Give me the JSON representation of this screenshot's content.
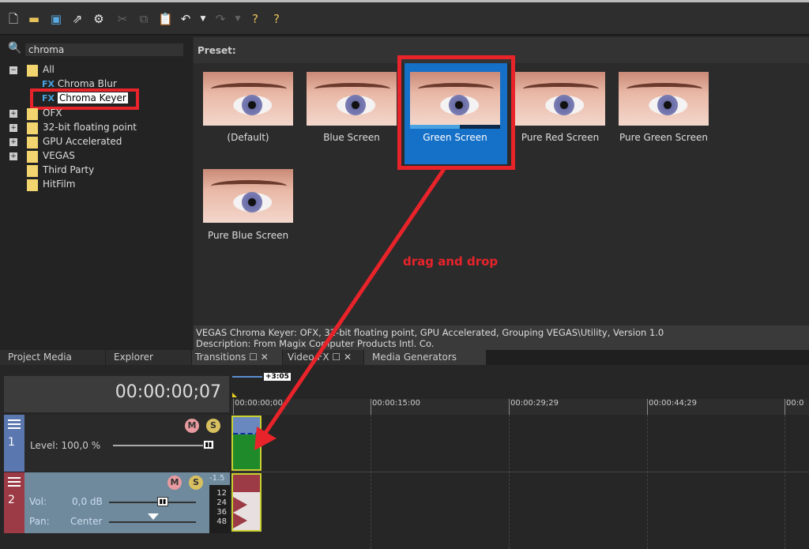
{
  "toolbar": {
    "icons": [
      "new-file",
      "open-folder",
      "save",
      "render",
      "settings",
      "cut",
      "copy",
      "paste",
      "undo",
      "undo-dropdown",
      "redo",
      "redo-dropdown",
      "whats-this-help",
      "context-help"
    ]
  },
  "search": {
    "value": "chroma"
  },
  "tree": {
    "items": [
      {
        "label": "All"
      },
      {
        "label": "Chroma Blur",
        "badge": "FX"
      },
      {
        "label": "Chroma Keyer",
        "badge": "FX"
      },
      {
        "label": "OFX"
      },
      {
        "label": "32-bit floating point"
      },
      {
        "label": "GPU Accelerated"
      },
      {
        "label": "VEGAS"
      },
      {
        "label": "Third Party"
      },
      {
        "label": "HitFilm"
      }
    ]
  },
  "preset": {
    "header": "Preset:",
    "items": [
      {
        "label": "(Default)"
      },
      {
        "label": "Blue Screen"
      },
      {
        "label": "Green Screen",
        "selected": true
      },
      {
        "label": "Pure Red Screen"
      },
      {
        "label": "Pure Green Screen"
      },
      {
        "label": "Pure Blue Screen"
      }
    ]
  },
  "annotation": {
    "text": "drag and drop",
    "color": "#e8232a"
  },
  "info": {
    "line1": "VEGAS Chroma Keyer: OFX, 32-bit floating point, GPU Accelerated, Grouping VEGAS\\Utility, Version 1.0",
    "line2": "Description: From Magix Computer Products Intl. Co."
  },
  "tabs": [
    {
      "label": "Project Media"
    },
    {
      "label": "Explorer"
    },
    {
      "label": "Transitions"
    },
    {
      "label": "Video FX"
    },
    {
      "label": "Media Generators"
    }
  ],
  "timeline": {
    "timecode": "00:00:00;07",
    "loop_length": "+3:05",
    "ruler": [
      "00:00:00;00",
      "00:00:15:00",
      "00:00:29;29",
      "00:00:44;29",
      "00:0"
    ],
    "track1": {
      "number": "1",
      "level_label": "Level: 100,0 %",
      "level": 1.0,
      "color": "#5a77b0"
    },
    "track2": {
      "number": "2",
      "vol_label": "Vol:",
      "vol_value": "0,0 dB",
      "pan_label": "Pan:",
      "pan_value": "Center",
      "peak": "-1.5",
      "meter": [
        "12",
        "24",
        "36",
        "48"
      ],
      "color": "#9c3a45"
    }
  },
  "colors": {
    "selection": "#1570c8",
    "highlight_border": "#e8232a",
    "video_event": "#1f8a2a"
  }
}
